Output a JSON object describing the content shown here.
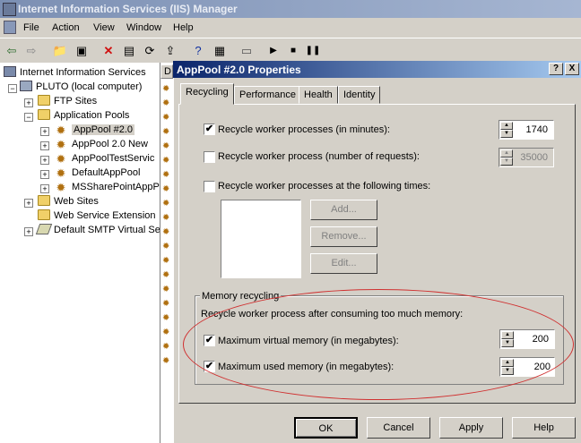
{
  "window": {
    "title": "Internet Information Services (IIS) Manager"
  },
  "menu": [
    "File",
    "Action",
    "View",
    "Window",
    "Help"
  ],
  "toolbar": {
    "icons": [
      "back-arrow-icon",
      "forward-arrow-icon",
      "up-folder-icon",
      "show-hide-tree-icon",
      "delete-icon",
      "properties-icon",
      "refresh-icon",
      "export-icon",
      "help-icon",
      "console-icon",
      "computer-icon",
      "play-icon",
      "stop-icon",
      "pause-icon"
    ]
  },
  "tree": {
    "items": [
      {
        "label": "Internet Information Services"
      },
      {
        "label": "PLUTO (local computer)"
      },
      {
        "label": "FTP Sites"
      },
      {
        "label": "Application Pools"
      },
      {
        "label": "AppPool #2.0"
      },
      {
        "label": "AppPool 2.0 New"
      },
      {
        "label": "AppPoolTestServic"
      },
      {
        "label": "DefaultAppPool"
      },
      {
        "label": "MSSharePointAppP"
      },
      {
        "label": "Web Sites"
      },
      {
        "label": "Web Service Extension"
      },
      {
        "label": "Default SMTP Virtual Se"
      }
    ],
    "list_header_letter": "D"
  },
  "dialog": {
    "title": "AppPool #2.0 Properties",
    "help_btn": "?",
    "close_btn": "X",
    "tabs": [
      "Recycling",
      "Performance",
      "Health",
      "Identity"
    ],
    "recycle_minutes": {
      "label": "Recycle worker processes (in minutes):",
      "checked": true,
      "value": "1740"
    },
    "recycle_requests": {
      "label": "Recycle worker process (number of requests):",
      "checked": false,
      "value": "35000"
    },
    "recycle_times": {
      "label": "Recycle worker processes at the following times:",
      "checked": false
    },
    "times_buttons": {
      "add": "Add...",
      "remove": "Remove...",
      "edit": "Edit..."
    },
    "memory": {
      "group_title": "Memory recycling",
      "description": "Recycle worker process after consuming too much memory:",
      "virtual": {
        "label": "Maximum virtual memory (in megabytes):",
        "checked": true,
        "value": "200"
      },
      "used": {
        "label": "Maximum used memory (in megabytes):",
        "checked": true,
        "value": "200"
      }
    },
    "buttons": {
      "ok": "OK",
      "cancel": "Cancel",
      "apply": "Apply",
      "help": "Help"
    }
  },
  "colors": {
    "annotation_ellipse": "#d03030",
    "title_active": "#0a246a"
  }
}
